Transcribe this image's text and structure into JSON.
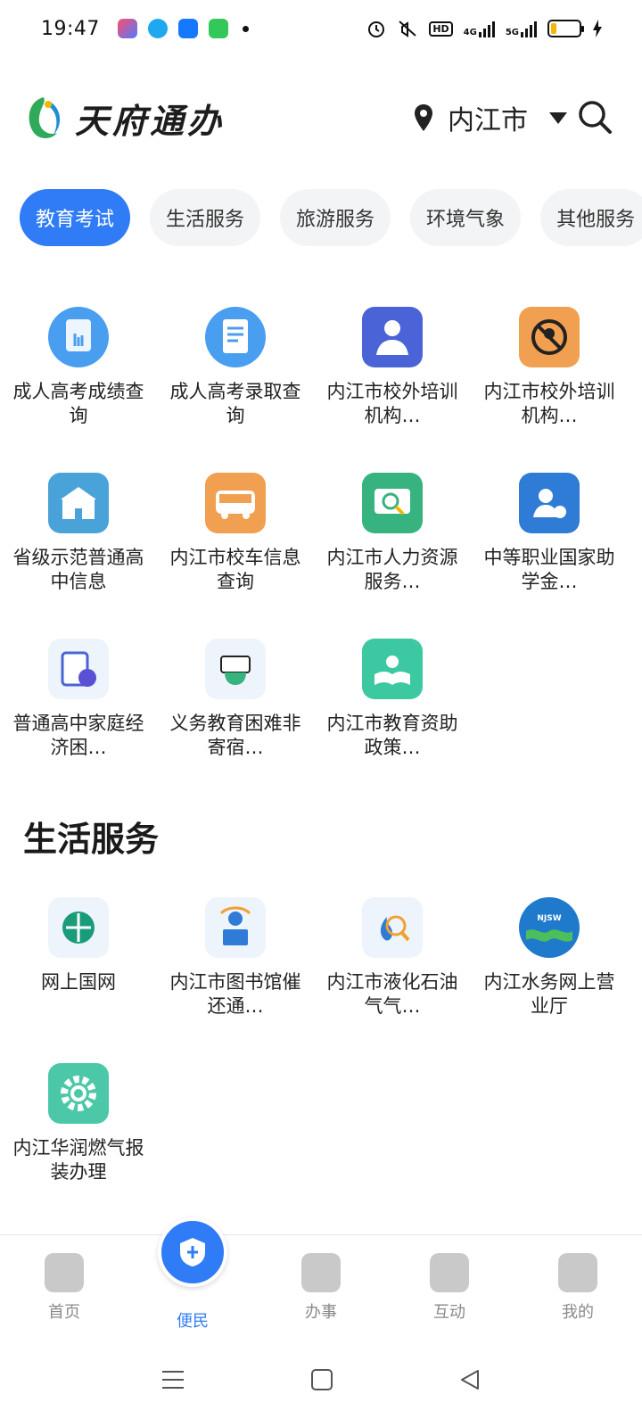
{
  "status_bar": {
    "time": "19:47",
    "network_1": "4G",
    "network_2": "5G",
    "battery_level": 0.2
  },
  "header": {
    "logo_text": "天府通办",
    "location": "内江市"
  },
  "tabs": [
    {
      "label": "教育考试",
      "active": true
    },
    {
      "label": "生活服务",
      "active": false
    },
    {
      "label": "旅游服务",
      "active": false
    },
    {
      "label": "环境气象",
      "active": false
    },
    {
      "label": "其他服务",
      "active": false
    }
  ],
  "education_items": [
    {
      "label": "成人高考成绩查询",
      "icon": "exam-score-icon",
      "color": "#4a9ef0"
    },
    {
      "label": "成人高考录取查询",
      "icon": "admission-doc-icon",
      "color": "#4a9ef0"
    },
    {
      "label": "内江市校外培训机构…",
      "icon": "teacher-icon",
      "color": "#4a63d6"
    },
    {
      "label": "内江市校外培训机构…",
      "icon": "prohibited-person-icon",
      "color": "#f0a050"
    },
    {
      "label": "省级示范普通高中信息",
      "icon": "school-building-icon",
      "color": "#4aa3d8"
    },
    {
      "label": "内江市校车信息查询",
      "icon": "school-bus-icon",
      "color": "#f0a050"
    },
    {
      "label": "内江市人力资源服务…",
      "icon": "hr-search-icon",
      "color": "#36b37e"
    },
    {
      "label": "中等职业国家助学金…",
      "icon": "scholarship-icon",
      "color": "#2f7cd6"
    },
    {
      "label": "普通高中家庭经济困…",
      "icon": "finance-clipboard-icon",
      "color": "#4a63d6"
    },
    {
      "label": "义务教育困难非寄宿…",
      "icon": "money-hand-icon",
      "color": "#36b37e"
    },
    {
      "label": "内江市教育资助政策…",
      "icon": "book-lightbulb-icon",
      "color": "#3cc8a0"
    }
  ],
  "life_section_title": "生活服务",
  "life_items": [
    {
      "label": "网上国网",
      "icon": "state-grid-icon",
      "color": "#1a9c7a"
    },
    {
      "label": "内江市图书馆催还通…",
      "icon": "library-reader-icon",
      "color": "#2f7cd6"
    },
    {
      "label": "内江市液化石油气气…",
      "icon": "gas-search-icon",
      "color": "#2f7cd6"
    },
    {
      "label": "内江水务网上营业厅",
      "icon": "njsw-water-icon",
      "color": "#1f7acc"
    },
    {
      "label": "内江华润燃气报装办理",
      "icon": "gear-icon",
      "color": "#4cc8a8"
    }
  ],
  "bottom_nav": [
    {
      "label": "首页",
      "icon": "home-icon",
      "active": false
    },
    {
      "label": "便民",
      "icon": "convenience-icon",
      "active": true
    },
    {
      "label": "办事",
      "icon": "affairs-icon",
      "active": false
    },
    {
      "label": "互动",
      "icon": "interact-icon",
      "active": false
    },
    {
      "label": "我的",
      "icon": "profile-icon",
      "active": false
    }
  ],
  "colors": {
    "accent": "#2f7cf6",
    "tab_bg": "#f3f4f6",
    "nav_inactive": "#8a8a8a"
  }
}
